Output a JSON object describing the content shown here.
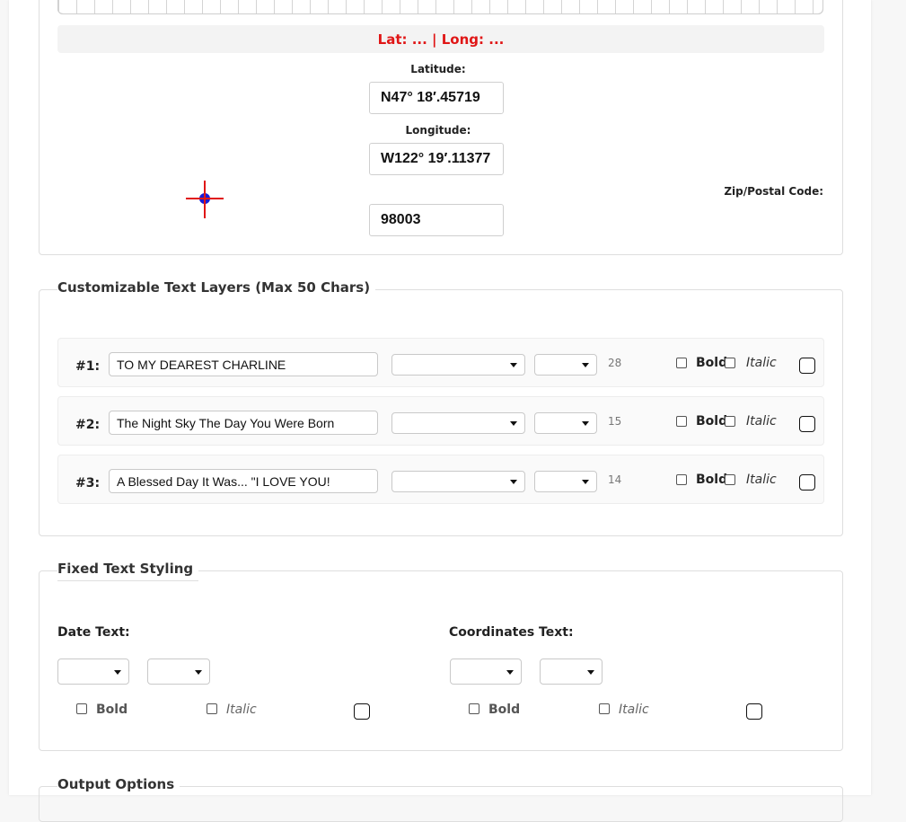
{
  "location": {
    "latlong_readout": "Lat: ... | Long: ...",
    "latitude_label": "Latitude:",
    "latitude_value": "N47° 18′.45719",
    "longitude_label": "Longitude:",
    "longitude_value": "W122° 19′.11377",
    "zip_label": "Zip/Postal Code:",
    "zip_value": "98003",
    "crosshair_icon": "crosshair-target-icon"
  },
  "text_layers": {
    "legend": "Customizable Text Layers (Max 50 Chars)",
    "bold_label": "Bold",
    "italic_label": "Italic",
    "rows": [
      {
        "num": "#1:",
        "text": "TO MY DEAREST CHARLINE",
        "size": "28"
      },
      {
        "num": "#2:",
        "text": "The Night Sky The Day You Were Born",
        "size": "15"
      },
      {
        "num": "#3:",
        "text": "A Blessed Day It Was... \"I LOVE YOU!",
        "size": "14"
      }
    ]
  },
  "fixed_text": {
    "legend": "Fixed Text Styling",
    "date_label": "Date Text:",
    "coords_label": "Coordinates Text:",
    "bold_label": "Bold",
    "italic_label": "Italic"
  },
  "output": {
    "legend": "Output Options"
  },
  "colors": {
    "accent_red": "#e01616",
    "crosshair_red": "#e01616",
    "crosshair_blue": "#1a1ad6"
  }
}
